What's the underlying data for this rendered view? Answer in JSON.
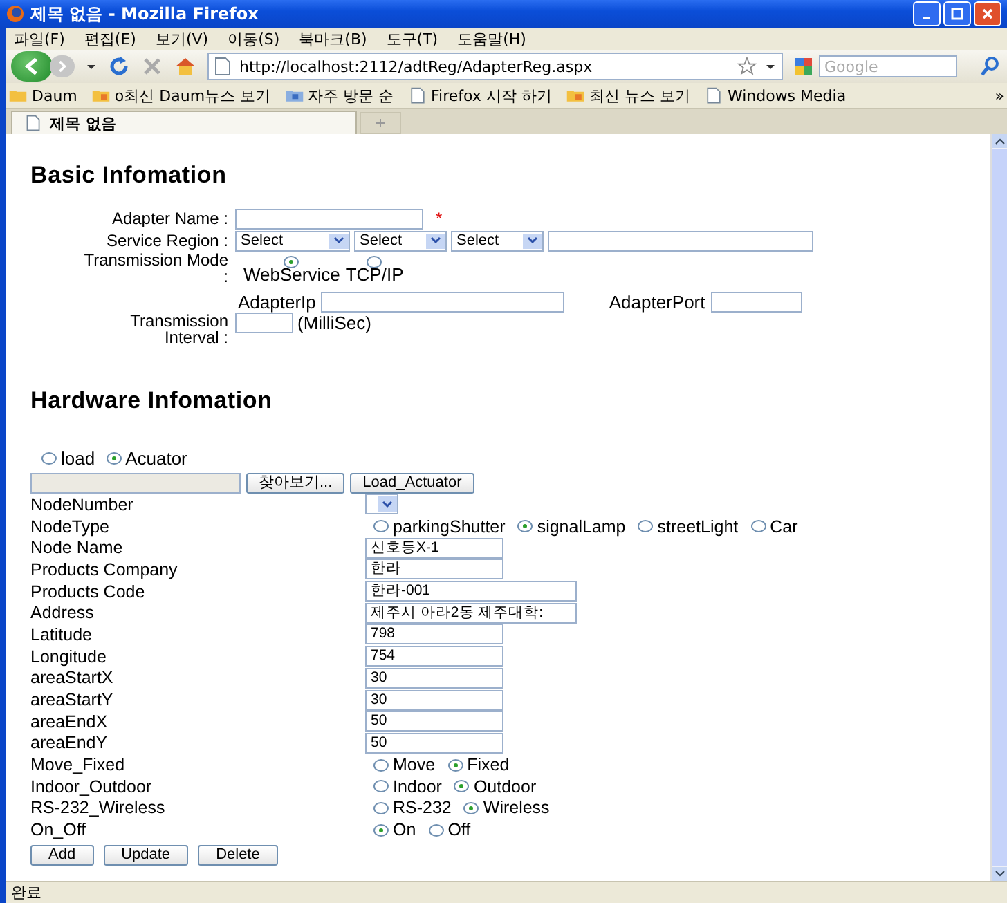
{
  "window": {
    "title": "제목 없음 - Mozilla Firefox"
  },
  "menu": [
    "파일(F)",
    "편집(E)",
    "보기(V)",
    "이동(S)",
    "북마크(B)",
    "도구(T)",
    "도움말(H)"
  ],
  "toolbar": {
    "url": "http://localhost:2112/adtReg/AdapterReg.aspx",
    "search_placeholder": "Google"
  },
  "bookmarks": [
    {
      "label": "Daum",
      "kind": "folder"
    },
    {
      "label": "o최신 Daum뉴스 보기",
      "kind": "feed"
    },
    {
      "label": "자주 방문 순",
      "kind": "smart"
    },
    {
      "label": "Firefox 시작 하기",
      "kind": "page"
    },
    {
      "label": "최신 뉴스 보기",
      "kind": "feed"
    },
    {
      "label": "Windows Media",
      "kind": "page"
    }
  ],
  "bookmarks_more": "»",
  "tabs": [
    {
      "label": "제목 없음",
      "selected": true
    }
  ],
  "basic": {
    "heading": "Basic Infomation",
    "adapter_name": {
      "label": "Adapter Name :",
      "required": "*"
    },
    "service_region": {
      "label": "Service Region :",
      "selects": [
        "Select",
        "Select",
        "Select"
      ]
    },
    "transmission_mode": {
      "label": "Transmission Mode :",
      "options": [
        {
          "label": "WebService",
          "selected": true
        },
        {
          "label": "TCP/IP",
          "selected": false
        }
      ]
    },
    "adapter_ip": {
      "label": "AdapterIp"
    },
    "adapter_port": {
      "label": "AdapterPort"
    },
    "interval": {
      "label": "Transmission Interval :",
      "unit": "(MilliSec)"
    }
  },
  "hardware": {
    "heading": "Hardware Infomation",
    "source": [
      {
        "label": "load",
        "selected": false
      },
      {
        "label": "Acuator",
        "selected": true
      }
    ],
    "browse_button": "찾아보기...",
    "load_button": "Load_Actuator",
    "rows": [
      {
        "label": "NodeNumber",
        "kind": "select"
      },
      {
        "label": "NodeType",
        "kind": "radio",
        "options": [
          {
            "label": "parkingShutter",
            "selected": false
          },
          {
            "label": "signalLamp",
            "selected": true
          },
          {
            "label": "streetLight",
            "selected": false
          },
          {
            "label": "Car",
            "selected": false
          }
        ]
      },
      {
        "label": "Node Name",
        "kind": "text",
        "value": "신호등X-1"
      },
      {
        "label": "Products Company",
        "kind": "text",
        "value": "한라"
      },
      {
        "label": "Products Code",
        "kind": "wide",
        "value": "한라-001"
      },
      {
        "label": "Address",
        "kind": "wide",
        "value": "제주시 아라2동 제주대학:"
      },
      {
        "label": "Latitude",
        "kind": "text",
        "value": "798"
      },
      {
        "label": "Longitude",
        "kind": "text",
        "value": "754"
      },
      {
        "label": "areaStartX",
        "kind": "text",
        "value": "30"
      },
      {
        "label": "areaStartY",
        "kind": "text",
        "value": "30"
      },
      {
        "label": "areaEndX",
        "kind": "text",
        "value": "50"
      },
      {
        "label": "areaEndY",
        "kind": "text",
        "value": "50"
      },
      {
        "label": "Move_Fixed",
        "kind": "radio",
        "options": [
          {
            "label": "Move",
            "selected": false
          },
          {
            "label": "Fixed",
            "selected": true
          }
        ]
      },
      {
        "label": "Indoor_Outdoor",
        "kind": "radio",
        "options": [
          {
            "label": "Indoor",
            "selected": false
          },
          {
            "label": "Outdoor",
            "selected": true
          }
        ]
      },
      {
        "label": "RS-232_Wireless",
        "kind": "radio",
        "options": [
          {
            "label": "RS-232",
            "selected": false
          },
          {
            "label": "Wireless",
            "selected": true
          }
        ]
      },
      {
        "label": "On_Off",
        "kind": "radio",
        "options": [
          {
            "label": "On",
            "selected": true
          },
          {
            "label": "Off",
            "selected": false
          }
        ]
      }
    ],
    "buttons": [
      "Add",
      "Update",
      "Delete"
    ]
  },
  "status_bar": {
    "text": "완료"
  }
}
